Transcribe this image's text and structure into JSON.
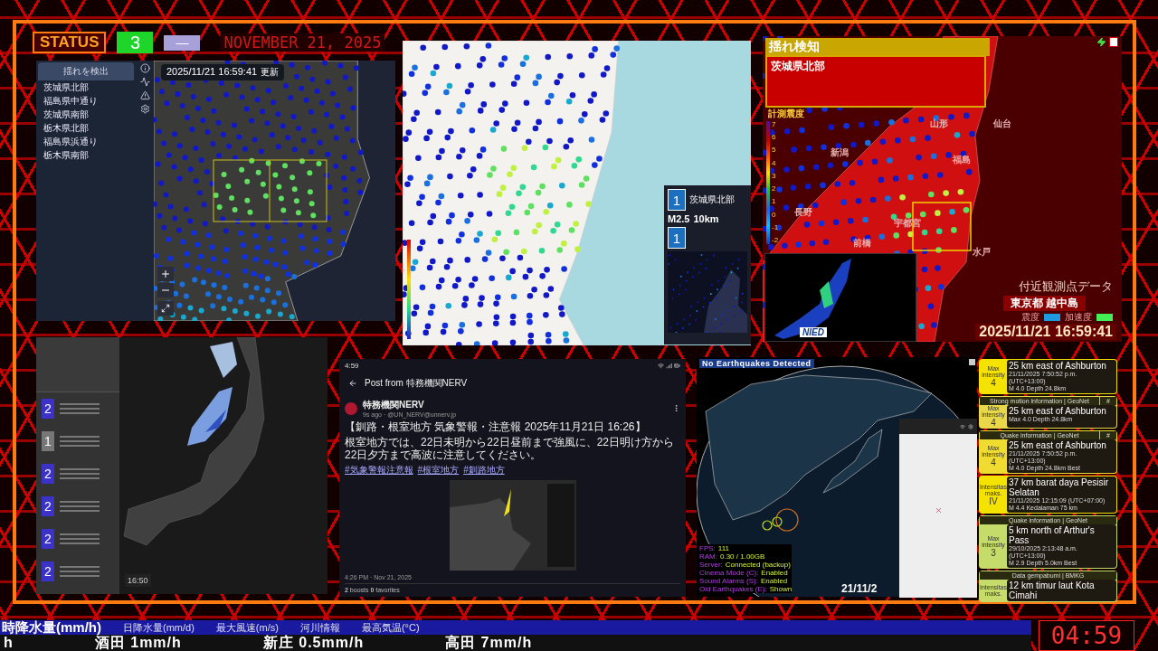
{
  "header": {
    "status_label": "STATUS",
    "level": "3",
    "mode": "—",
    "date": "NOVEMBER 21, 2025"
  },
  "detection_panel": {
    "title": "揺れを検出",
    "regions": [
      "茨城県北部",
      "福島県中通り",
      "茨城県南部",
      "栃木県北部",
      "福島県浜通り",
      "栃木県南部"
    ],
    "timestamp": "2025/11/21 16:59:41",
    "updated_label": "更新"
  },
  "station_map": {
    "epicenter_card": {
      "intensity": "1",
      "region": "茨城県北部",
      "magnitude": "M2.5",
      "depth": "10km",
      "second_intensity": "1"
    }
  },
  "shake_panel": {
    "title": "揺れ検知",
    "region": "茨城県北部",
    "scale_title": "計測震度",
    "scale_labels": [
      "7",
      "6",
      "5",
      "4",
      "3",
      "2",
      "1",
      "0",
      "-1",
      "-2"
    ],
    "places": [
      "山形",
      "仙台",
      "新潟",
      "福島",
      "長野",
      "宇都宮",
      "前橋",
      "水戸"
    ],
    "logo": "NIED",
    "nearby_title": "付近観測点データ",
    "station": "東京都 越中島",
    "legend": [
      {
        "label": "震度",
        "color": "#1e9be0"
      },
      {
        "label": "加速度",
        "color": "#44ee55"
      }
    ],
    "timestamp": "2025/11/21 16:59:41"
  },
  "quake_list": {
    "items": [
      {
        "intensity": "2",
        "color": "#3b32c8"
      },
      {
        "intensity": "1",
        "color": "#777777"
      },
      {
        "intensity": "2",
        "color": "#3b32c8"
      },
      {
        "intensity": "2",
        "color": "#3b32c8"
      },
      {
        "intensity": "2",
        "color": "#3b32c8"
      },
      {
        "intensity": "2",
        "color": "#3b32c8"
      }
    ],
    "radar_time": "16:50"
  },
  "post": {
    "status_time": "4:59",
    "title": "Post from 特務機関NERV",
    "author": "特務機関NERV",
    "meta": "9s ago · @UN_NERV@unnerv.jp",
    "headline": "【釧路・根室地方 気象警報・注意報 2025年11月21日 16:26】",
    "body": "根室地方では、22日未明から22日昼前まで強風に、22日明け方から22日夕方まで高波に注意してください。",
    "hashtags": [
      "#気象警報注意報",
      "#根室地方",
      "#釧路地方"
    ],
    "timestamp": "4:26 PM · Nov 21, 2025",
    "stats": "**2** boosts  **0** favorites"
  },
  "globe": {
    "banner": "No Earthquakes Detected",
    "stats": [
      {
        "label": "FPS:",
        "value": "111"
      },
      {
        "label": "RAM:",
        "value": "0.30 / 1.00GB"
      },
      {
        "label": "Server:",
        "value": "Connected (backup)"
      },
      {
        "label": "Cinema Mode (C):",
        "value": "Enabled"
      },
      {
        "label": "Sound Alarms (S):",
        "value": "Enabled"
      },
      {
        "label": "Old Earthquakes (E):",
        "value": "Shown"
      }
    ],
    "date": "21/11/2"
  },
  "cards": [
    {
      "color": "#f4e200",
      "intensity_label": "Max intensity",
      "intensity": "4",
      "place": "25 km east of Ashburton",
      "time": "21/11/2025 7:50:52 p.m. (UTC+13:00)",
      "details": "M 4.0   Depth 24.8km"
    },
    {
      "color": "#e8d84a",
      "header": "Strong motion information | GeoNet",
      "header_mark": "#",
      "intensity_label": "Max intensity",
      "intensity": "4",
      "place": "25 km east of Ashburton",
      "details": "Max 4.0   Depth 24.8km"
    },
    {
      "color": "#f0dc30",
      "header": "Quake information | GeoNet",
      "header_mark": "#",
      "intensity_label": "Max intensity",
      "intensity": "4",
      "place": "25 km east of Ashburton",
      "time": "21/11/2025 7:50:52 p.m. (UTC+13:00)",
      "details": "M 4.0   Depth 24.8km   Best"
    },
    {
      "color": "#f4e200",
      "intensity_label": "Intensitas maks.",
      "intensity": "IV",
      "place": "37 km barat daya Pesisir Selatan",
      "time": "21/11/2025 12:15:09 (UTC+07:00)",
      "details": "M 4.4   Kedalaman 75 km"
    },
    {
      "color": "#c6dc6a",
      "header": "Quake information | GeoNet",
      "intensity_label": "Max intensity",
      "intensity": "3",
      "place": "5 km north of Arthur's Pass",
      "time": "29/10/2025 2:13:48 a.m. (UTC+13:00)",
      "details": "M 2.9   Depth 5.0km   Best"
    },
    {
      "color": "#c6dc6a",
      "header": "Data gempabumi | BMKG",
      "intensity_label": "Intensitas maks.",
      "place": "12 km timur laut Kota Cimahi"
    }
  ],
  "ticker": {
    "tabs": [
      {
        "label": "時降水量(mm/h)",
        "selected": true
      },
      {
        "label": "日降水量(mm/d)",
        "selected": false
      },
      {
        "label": "最大風速(m/s)",
        "selected": false
      },
      {
        "label": "河川情報",
        "selected": false
      },
      {
        "label": "最高気温(°C)",
        "selected": false
      }
    ],
    "items": [
      "h",
      "酒田 1mm/h",
      "新庄 0.5mm/h",
      "高田 7mm/h"
    ],
    "clock": "04:59"
  }
}
